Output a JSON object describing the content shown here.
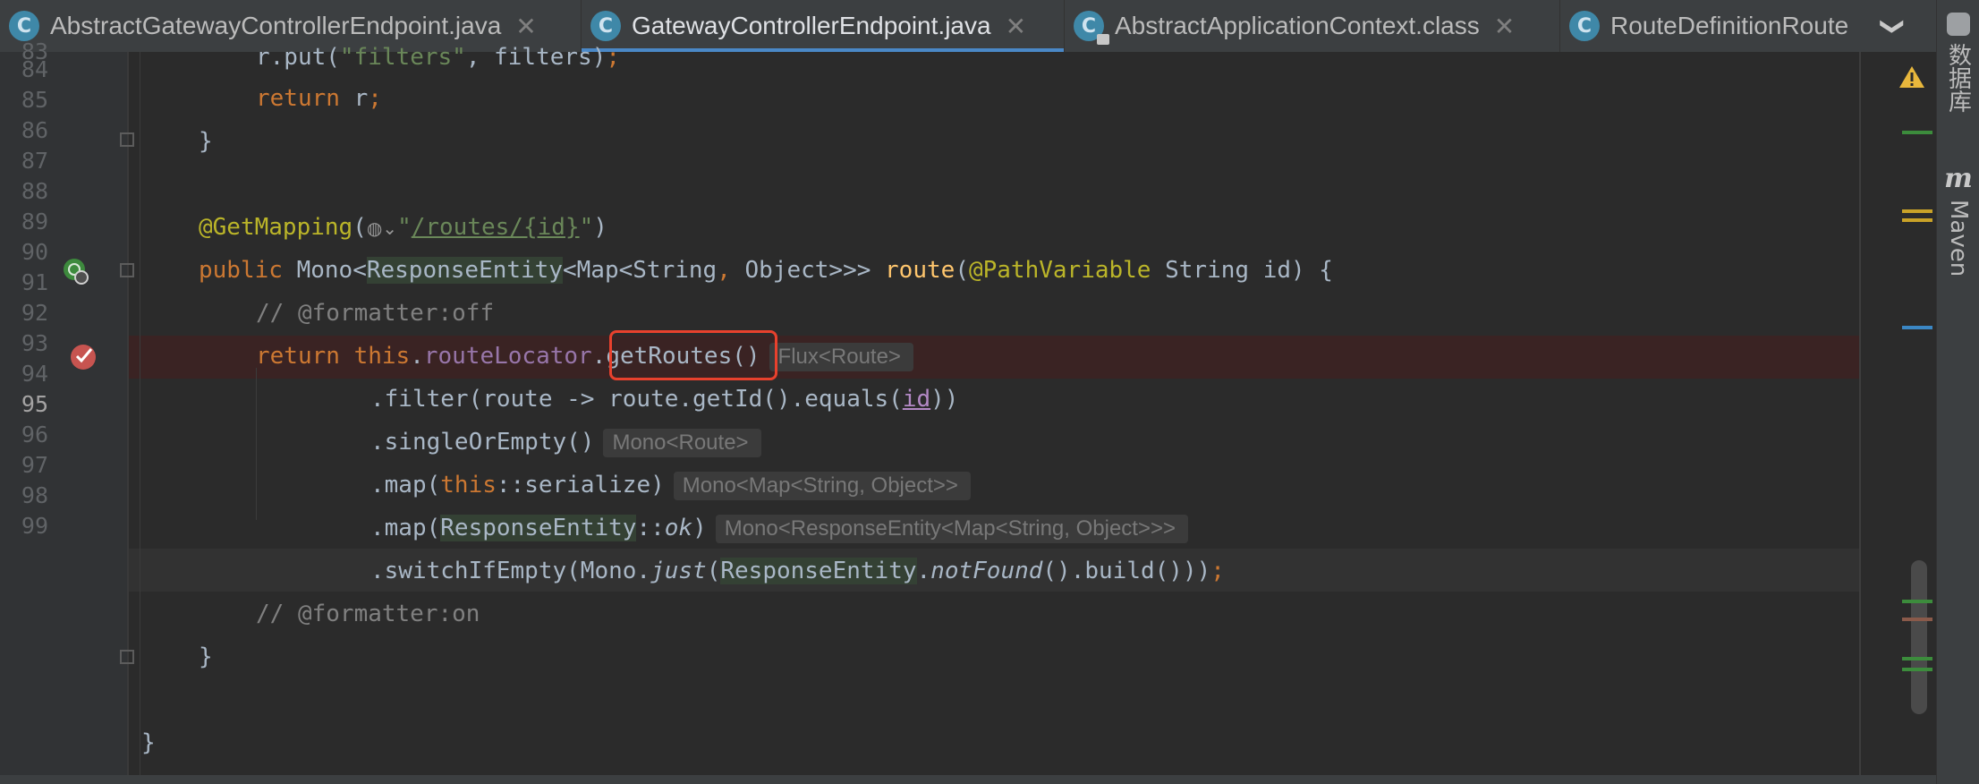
{
  "tabs": [
    {
      "label": "AbstractGatewayControllerEndpoint.java",
      "icon": "class-icon",
      "active": false,
      "closable": true
    },
    {
      "label": "GatewayControllerEndpoint.java",
      "icon": "class-icon",
      "active": true,
      "closable": true
    },
    {
      "label": "AbstractApplicationContext.class",
      "icon": "locked-class-icon",
      "active": false,
      "closable": true
    },
    {
      "label": "RouteDefinitionRoute",
      "icon": "class-icon",
      "active": false,
      "closable": false
    }
  ],
  "icon_glyphs": {
    "class": "C",
    "close": "✕",
    "overflow": "❯"
  },
  "right_sidebar": {
    "database_label": "数据库",
    "maven_label": "Maven",
    "maven_glyph": "m"
  },
  "editor": {
    "line_numbers": [
      "83",
      "84",
      "85",
      "86",
      "87",
      "88",
      "89",
      "90",
      "91",
      "92",
      "93",
      "94",
      "95",
      "96",
      "97",
      "98",
      "99"
    ],
    "current_line": "95",
    "breakpoint_line": "90",
    "hints": {
      "getRoutes": "Flux<Route>",
      "singleOrEmpty": "Mono<Route>",
      "serialize": "Mono<Map<String, Object>>",
      "ok": "Mono<ResponseEntity<Map<String, Object>>>"
    },
    "url_value": "/routes/{id}",
    "highlighted_call": "getRoutes()"
  },
  "colors": {
    "keyword": "#cc7832",
    "annotation": "#bbb529",
    "string": "#6a8759",
    "comment": "#808080",
    "field": "#9876aa",
    "method": "#ffc66d",
    "highlight_box": "#e8412d",
    "active_tab_underline": "#4a88c7"
  }
}
